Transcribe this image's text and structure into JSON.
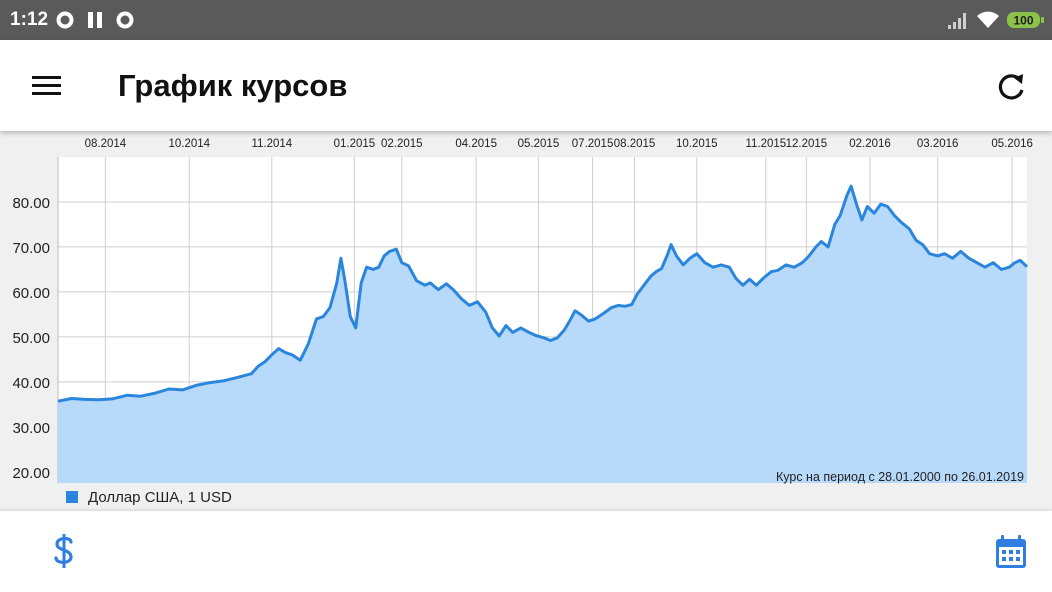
{
  "status_bar": {
    "time": "1:12",
    "battery": "100",
    "battery_color": "#8bc34a",
    "icons": [
      "record-icon",
      "pause-icon",
      "record-icon",
      "signal-icon",
      "wifi-icon",
      "battery-icon"
    ]
  },
  "app_bar": {
    "title": "График курсов",
    "menu_icon": "hamburger-menu-icon",
    "refresh_icon": "refresh-icon"
  },
  "bottom_bar": {
    "currency_icon": "dollar-icon",
    "calendar_icon": "calendar-icon",
    "accent": "#2f7ee0"
  },
  "chart_data": {
    "type": "area",
    "ylim": [
      17.5,
      90
    ],
    "y_ticks": [
      20,
      30,
      40,
      50,
      60,
      70,
      80
    ],
    "y_tick_labels": [
      "20.00",
      "30.00",
      "40.00",
      "50.00",
      "60.00",
      "70.00",
      "80.00"
    ],
    "x_range": [
      "2014-06-20",
      "2016-06-05"
    ],
    "x_ticks": [
      {
        "date": "2014-07-25",
        "label": "08.2014"
      },
      {
        "date": "2014-09-25",
        "label": "10.2014"
      },
      {
        "date": "2014-11-25",
        "label": "11.2014"
      },
      {
        "date": "2015-01-25",
        "label": "01.2015"
      },
      {
        "date": "2015-03-01",
        "label": "02.2015"
      },
      {
        "date": "2015-04-25",
        "label": "04.2015"
      },
      {
        "date": "2015-06-10",
        "label": "05.2015"
      },
      {
        "date": "2015-07-20",
        "label": "07.2015"
      },
      {
        "date": "2015-08-20",
        "label": "08.2015"
      },
      {
        "date": "2015-10-05",
        "label": "10.2015"
      },
      {
        "date": "2015-11-25",
        "label": "11.2015"
      },
      {
        "date": "2015-12-25",
        "label": "12.2015"
      },
      {
        "date": "2016-02-10",
        "label": "02.2016"
      },
      {
        "date": "2016-03-31",
        "label": "03.2016"
      },
      {
        "date": "2016-05-25",
        "label": "05.2016"
      }
    ],
    "grid": true,
    "line_color": "#2a86dc",
    "fill_color": "#b4d8fa",
    "period_note": "Курс на период с 28.01.2000 по 26.01.2019",
    "series": [
      {
        "name": "Доллар США, 1 USD",
        "points": [
          [
            "2014-06-20",
            35.7
          ],
          [
            "2014-06-30",
            36.3
          ],
          [
            "2014-07-10",
            36.1
          ],
          [
            "2014-07-20",
            36.0
          ],
          [
            "2014-07-30",
            36.2
          ],
          [
            "2014-08-10",
            37.0
          ],
          [
            "2014-08-20",
            36.8
          ],
          [
            "2014-08-31",
            37.5
          ],
          [
            "2014-09-10",
            38.4
          ],
          [
            "2014-09-20",
            38.2
          ],
          [
            "2014-09-30",
            39.2
          ],
          [
            "2014-10-10",
            39.8
          ],
          [
            "2014-10-20",
            40.2
          ],
          [
            "2014-10-31",
            41.0
          ],
          [
            "2014-11-10",
            41.8
          ],
          [
            "2014-11-15",
            43.5
          ],
          [
            "2014-11-20",
            44.5
          ],
          [
            "2014-11-25",
            46.0
          ],
          [
            "2014-11-30",
            47.4
          ],
          [
            "2014-12-05",
            46.5
          ],
          [
            "2014-12-10",
            46.0
          ],
          [
            "2014-12-16",
            44.8
          ],
          [
            "2014-12-22",
            48.5
          ],
          [
            "2014-12-28",
            54.0
          ],
          [
            "2015-01-02",
            54.5
          ],
          [
            "2015-01-07",
            56.5
          ],
          [
            "2015-01-12",
            62.0
          ],
          [
            "2015-01-15",
            67.5
          ],
          [
            "2015-01-18",
            62.5
          ],
          [
            "2015-01-22",
            54.5
          ],
          [
            "2015-01-26",
            52.0
          ],
          [
            "2015-01-30",
            62.0
          ],
          [
            "2015-02-03",
            65.5
          ],
          [
            "2015-02-08",
            65.0
          ],
          [
            "2015-02-12",
            65.5
          ],
          [
            "2015-02-16",
            68.0
          ],
          [
            "2015-02-20",
            69.0
          ],
          [
            "2015-02-25",
            69.5
          ],
          [
            "2015-03-01",
            66.5
          ],
          [
            "2015-03-06",
            65.8
          ],
          [
            "2015-03-12",
            62.5
          ],
          [
            "2015-03-18",
            61.5
          ],
          [
            "2015-03-22",
            62.0
          ],
          [
            "2015-03-28",
            60.5
          ],
          [
            "2015-04-03",
            61.8
          ],
          [
            "2015-04-08",
            60.5
          ],
          [
            "2015-04-14",
            58.5
          ],
          [
            "2015-04-20",
            57.0
          ],
          [
            "2015-04-26",
            57.8
          ],
          [
            "2015-05-02",
            55.5
          ],
          [
            "2015-05-07",
            52.0
          ],
          [
            "2015-05-12",
            50.2
          ],
          [
            "2015-05-17",
            52.5
          ],
          [
            "2015-05-22",
            51.0
          ],
          [
            "2015-05-28",
            52.0
          ],
          [
            "2015-06-03",
            51.0
          ],
          [
            "2015-06-08",
            50.3
          ],
          [
            "2015-06-14",
            49.8
          ],
          [
            "2015-06-19",
            49.2
          ],
          [
            "2015-06-24",
            49.8
          ],
          [
            "2015-06-29",
            51.5
          ],
          [
            "2015-07-03",
            53.5
          ],
          [
            "2015-07-07",
            55.8
          ],
          [
            "2015-07-12",
            54.8
          ],
          [
            "2015-07-17",
            53.5
          ],
          [
            "2015-07-22",
            54.0
          ],
          [
            "2015-07-28",
            55.2
          ],
          [
            "2015-08-03",
            56.5
          ],
          [
            "2015-08-08",
            57.0
          ],
          [
            "2015-08-13",
            56.8
          ],
          [
            "2015-08-18",
            57.2
          ],
          [
            "2015-08-22",
            59.5
          ],
          [
            "2015-08-27",
            61.5
          ],
          [
            "2015-09-01",
            63.5
          ],
          [
            "2015-09-05",
            64.5
          ],
          [
            "2015-09-09",
            65.2
          ],
          [
            "2015-09-13",
            68.0
          ],
          [
            "2015-09-16",
            70.5
          ],
          [
            "2015-09-20",
            68.0
          ],
          [
            "2015-09-25",
            66.0
          ],
          [
            "2015-09-30",
            67.5
          ],
          [
            "2015-10-05",
            68.5
          ],
          [
            "2015-10-11",
            66.5
          ],
          [
            "2015-10-17",
            65.5
          ],
          [
            "2015-10-23",
            66.0
          ],
          [
            "2015-10-29",
            65.5
          ],
          [
            "2015-11-03",
            63.0
          ],
          [
            "2015-11-08",
            61.5
          ],
          [
            "2015-11-13",
            62.8
          ],
          [
            "2015-11-18",
            61.5
          ],
          [
            "2015-11-23",
            63.0
          ],
          [
            "2015-11-29",
            64.5
          ],
          [
            "2015-12-04",
            64.8
          ],
          [
            "2015-12-10",
            66.0
          ],
          [
            "2015-12-16",
            65.5
          ],
          [
            "2015-12-22",
            66.5
          ],
          [
            "2015-12-27",
            68.0
          ],
          [
            "2016-01-01",
            70.0
          ],
          [
            "2016-01-05",
            71.2
          ],
          [
            "2016-01-10",
            70.0
          ],
          [
            "2016-01-15",
            75.0
          ],
          [
            "2016-01-19",
            77.0
          ],
          [
            "2016-01-24",
            81.5
          ],
          [
            "2016-01-27",
            83.5
          ],
          [
            "2016-01-31",
            79.5
          ],
          [
            "2016-02-04",
            76.0
          ],
          [
            "2016-02-08",
            79.0
          ],
          [
            "2016-02-13",
            77.5
          ],
          [
            "2016-02-18",
            79.5
          ],
          [
            "2016-02-23",
            79.0
          ],
          [
            "2016-02-28",
            77.0
          ],
          [
            "2016-03-04",
            75.5
          ],
          [
            "2016-03-10",
            74.0
          ],
          [
            "2016-03-15",
            71.5
          ],
          [
            "2016-03-20",
            70.5
          ],
          [
            "2016-03-25",
            68.5
          ],
          [
            "2016-03-31",
            68.0
          ],
          [
            "2016-04-05",
            68.5
          ],
          [
            "2016-04-11",
            67.5
          ],
          [
            "2016-04-17",
            69.0
          ],
          [
            "2016-04-23",
            67.5
          ],
          [
            "2016-04-29",
            66.5
          ],
          [
            "2016-05-05",
            65.5
          ],
          [
            "2016-05-11",
            66.5
          ],
          [
            "2016-05-17",
            65.0
          ],
          [
            "2016-05-23",
            65.5
          ],
          [
            "2016-05-27",
            66.5
          ],
          [
            "2016-05-31",
            67.0
          ],
          [
            "2016-06-05",
            65.6
          ]
        ]
      }
    ]
  }
}
